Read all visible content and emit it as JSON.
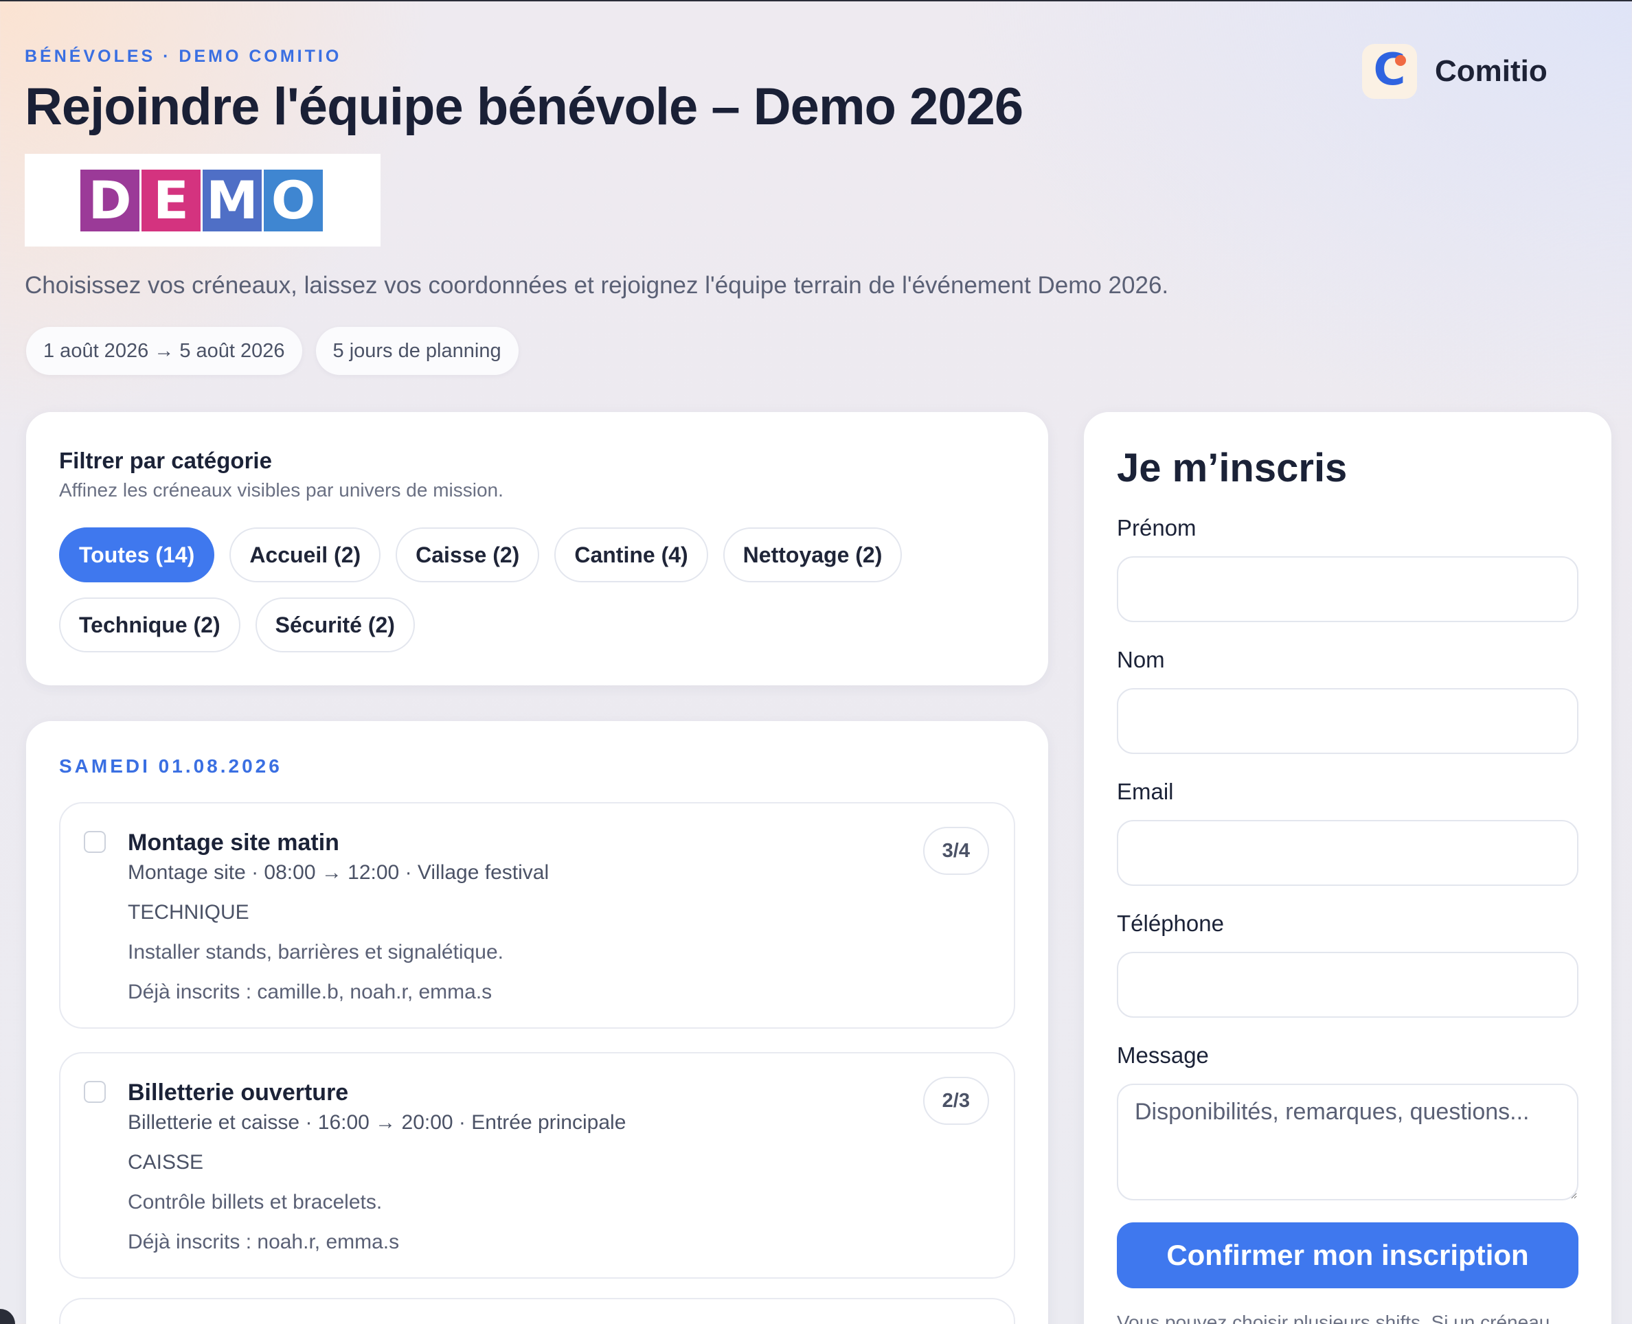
{
  "header": {
    "eyebrow": "BÉNÉVOLES · DEMO COMITIO",
    "title": "Rejoindre l'équipe bénévole – Demo 2026",
    "event_logo": {
      "letters": [
        "D",
        "E",
        "M",
        "O"
      ],
      "colors": [
        "#9b3a98",
        "#d4337f",
        "#4f6fc6",
        "#3f86d1"
      ]
    },
    "subtitle": "Choisissez vos créneaux, laissez vos coordonnées et rejoignez l'équipe terrain de l'événement Demo 2026.",
    "chips": [
      "1 août 2026 → 5 août 2026",
      "5 jours de planning"
    ]
  },
  "brand": {
    "icon": "comitio-logo-icon",
    "letter": "C",
    "name": "Comitio",
    "primary_color": "#2f63e0",
    "accent_color": "#f06a43"
  },
  "filter": {
    "title": "Filtrer par catégorie",
    "subtitle": "Affinez les créneaux visibles par univers de mission.",
    "pills": [
      {
        "label": "Toutes (14)",
        "active": true
      },
      {
        "label": "Accueil (2)",
        "active": false
      },
      {
        "label": "Caisse (2)",
        "active": false
      },
      {
        "label": "Cantine (4)",
        "active": false
      },
      {
        "label": "Nettoyage (2)",
        "active": false
      },
      {
        "label": "Technique (2)",
        "active": false
      },
      {
        "label": "Sécurité (2)",
        "active": false
      }
    ]
  },
  "schedule": {
    "day_label": "SAMEDI 01.08.2026",
    "slots": [
      {
        "title": "Montage site matin",
        "meta": "Montage site · 08:00 → 12:00 · Village festival",
        "category": "TECHNIQUE",
        "description": "Installer stands, barrières et signalétique.",
        "registered": "Déjà inscrits : camille.b, noah.r, emma.s",
        "count": "3/4"
      },
      {
        "title": "Billetterie ouverture",
        "meta": "Billetterie et caisse · 16:00 → 20:00 · Entrée principale",
        "category": "CAISSE",
        "description": "Contrôle billets et bracelets.",
        "registered": "Déjà inscrits : noah.r, emma.s",
        "count": "2/3"
      }
    ]
  },
  "form": {
    "title": "Je m’inscris",
    "fields": {
      "first_name": {
        "label": "Prénom",
        "value": ""
      },
      "last_name": {
        "label": "Nom",
        "value": ""
      },
      "email": {
        "label": "Email",
        "value": ""
      },
      "phone": {
        "label": "Téléphone",
        "value": ""
      },
      "message": {
        "label": "Message",
        "placeholder": "Disponibilités, remarques, questions...",
        "value": ""
      }
    },
    "submit_label": "Confirmer mon inscription",
    "note": "Vous pouvez choisir plusieurs shifts. Si un créneau"
  },
  "colors": {
    "accent": "#3f78ee",
    "eyebrow": "#3a6fe2"
  }
}
